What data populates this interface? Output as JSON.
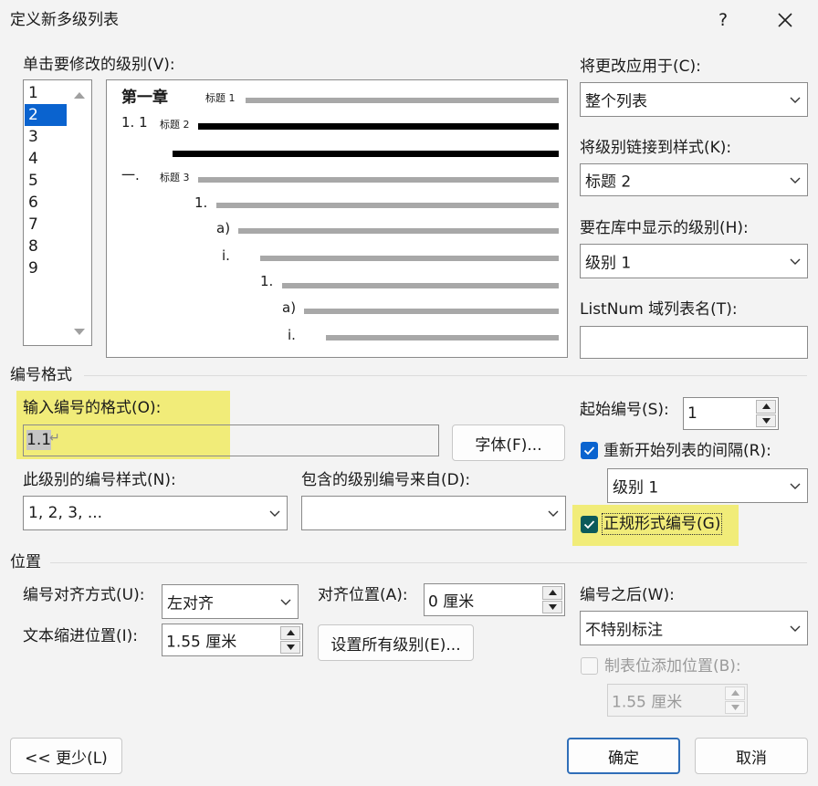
{
  "window": {
    "title": "定义新多级列表",
    "help_icon": "question-icon",
    "close_icon": "close-icon"
  },
  "levels": {
    "label": "单击要修改的级别(V):",
    "items": [
      "1",
      "2",
      "3",
      "4",
      "5",
      "6",
      "7",
      "8",
      "9"
    ],
    "selected": "2"
  },
  "preview": {
    "lines": [
      {
        "num": "第一章",
        "tag": "标题 1"
      },
      {
        "num": "1. 1",
        "tag": "标题 2"
      },
      {
        "num": "一.",
        "tag": "标题 3"
      },
      {
        "num": "1."
      },
      {
        "num": "a)"
      },
      {
        "num": "i."
      },
      {
        "num": "1."
      },
      {
        "num": "a)"
      },
      {
        "num": "i."
      }
    ]
  },
  "apply_to": {
    "label": "将更改应用于(C):",
    "value": "整个列表"
  },
  "link_style": {
    "label": "将级别链接到样式(K):",
    "value": "标题 2"
  },
  "gallery_level": {
    "label": "要在库中显示的级别(H):",
    "value": "级别 1"
  },
  "listnum": {
    "label": "ListNum 域列表名(T):",
    "value": ""
  },
  "number_format": {
    "section": "编号格式",
    "format_label": "输入编号的格式(O):",
    "format_value": "1.1",
    "format_mark": "↵",
    "font_button": "字体(F)...",
    "style_label": "此级别的编号样式(N):",
    "style_value": "1, 2, 3, ...",
    "include_label": "包含的级别编号来自(D):",
    "include_value": "",
    "start_label": "起始编号(S):",
    "start_value": "1",
    "restart_label": "重新开始列表的间隔(R):",
    "restart_checked": true,
    "restart_value": "级别 1",
    "legal_label": "正规形式编号(G)",
    "legal_checked": true
  },
  "position": {
    "section": "位置",
    "align_label": "编号对齐方式(U):",
    "align_value": "左对齐",
    "align_at_label": "对齐位置(A):",
    "align_at_value": "0 厘米",
    "indent_label": "文本缩进位置(I):",
    "indent_value": "1.55 厘米",
    "set_all_button": "设置所有级别(E)...",
    "follow_label": "编号之后(W):",
    "follow_value": "不特别标注",
    "tab_label": "制表位添加位置(B):",
    "tab_checked": false,
    "tab_value": "1.55 厘米"
  },
  "footer": {
    "less_button": "<< 更少(L)",
    "ok_button": "确定",
    "cancel_button": "取消"
  },
  "colors": {
    "accent": "#0a63cf",
    "highlight": "#f1ec79",
    "check_fill": "#0b5a5a"
  }
}
